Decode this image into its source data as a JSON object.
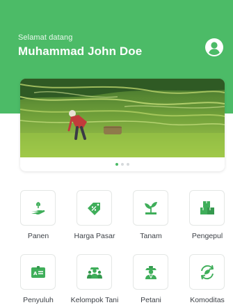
{
  "header": {
    "greeting": "Selamat datang",
    "username": "Muhammad John Doe",
    "profile_icon": "user-circle-icon"
  },
  "banner": {
    "image": "rice-terrace-farmer-photo",
    "slide_count": 3,
    "active_slide": 1
  },
  "menu": {
    "items": [
      {
        "label": "Panen",
        "icon": "harvest-hand-plant-icon"
      },
      {
        "label": "Harga Pasar",
        "icon": "price-tag-percent-icon"
      },
      {
        "label": "Tanam",
        "icon": "sprout-plant-icon"
      },
      {
        "label": "Pengepul",
        "icon": "boxes-stack-icon"
      },
      {
        "label": "Penyuluh",
        "icon": "id-card-icon"
      },
      {
        "label": "Kelompok Tani",
        "icon": "farmer-group-icon"
      },
      {
        "label": "Petani",
        "icon": "farmer-icon"
      },
      {
        "label": "Komoditas",
        "icon": "recycle-leaf-icon"
      }
    ]
  },
  "colors": {
    "primary": "#4CBB67",
    "icon_green": "#3FAE5A",
    "text": "#3B3F45"
  }
}
